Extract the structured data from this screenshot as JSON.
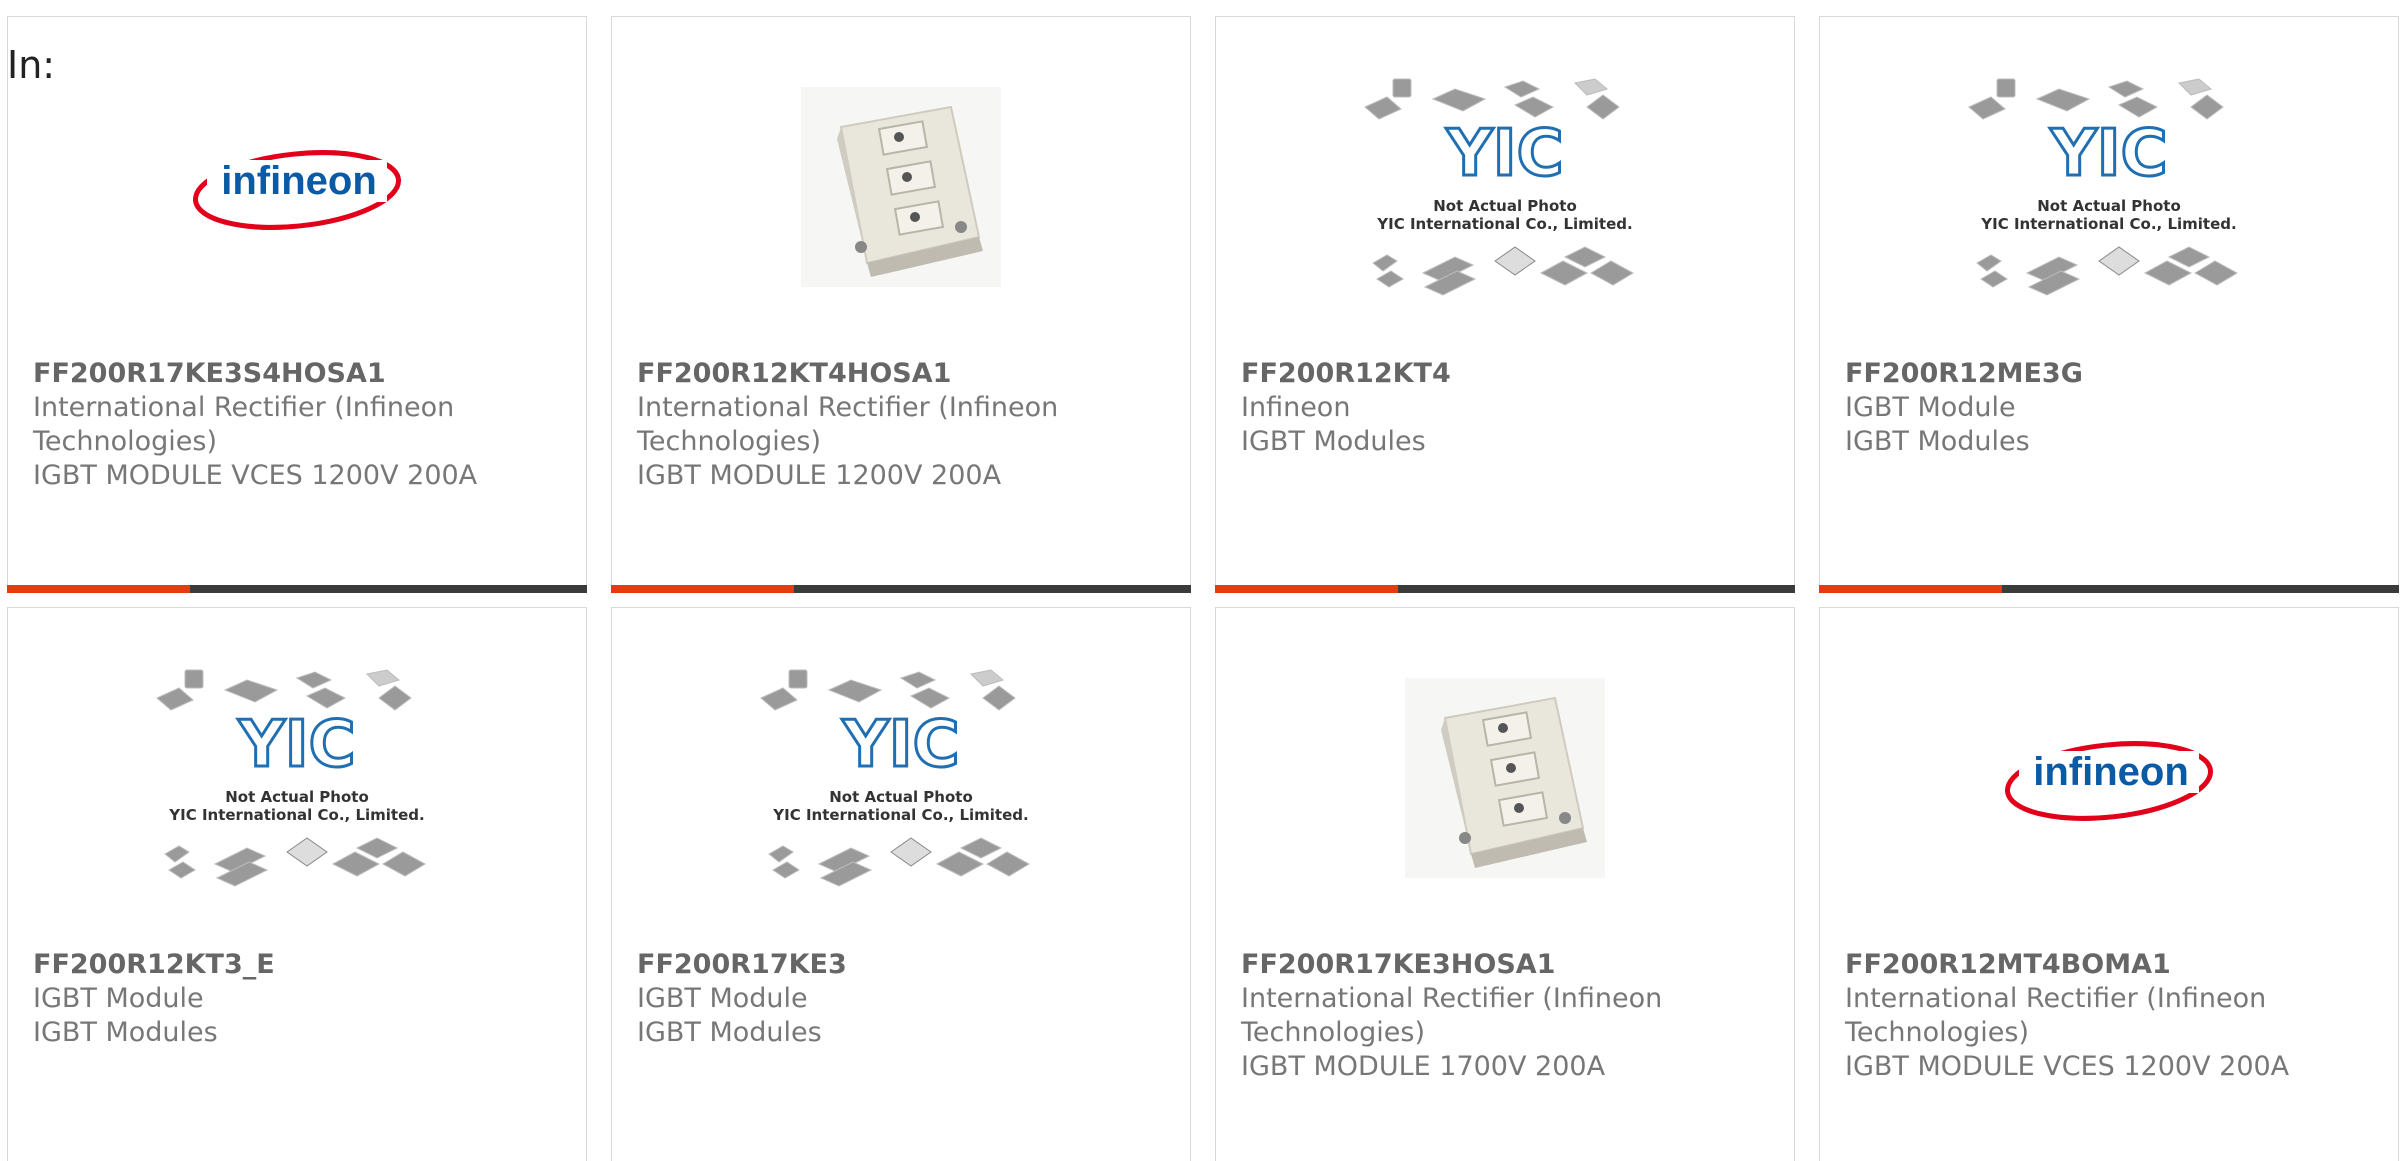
{
  "header": {
    "in_label": "In:"
  },
  "accent_color": "#e63a12",
  "bar_color": "#3b3b3b",
  "products": [
    {
      "part": "FF200R17KE3S4HOSA1",
      "manufacturer": "International Rectifier (Infineon Technologies)",
      "description": "IGBT MODULE VCES 1200V 200A",
      "image": "infineon-logo",
      "logo_text": "infineon"
    },
    {
      "part": "FF200R12KT4HOSA1",
      "manufacturer": "International Rectifier (Infineon Technologies)",
      "description": "IGBT MODULE 1200V 200A",
      "image": "module-photo"
    },
    {
      "part": "FF200R12KT4",
      "manufacturer": "Infineon",
      "description": "IGBT Modules",
      "image": "yic-placeholder",
      "placeholder_line1": "Not Actual Photo",
      "placeholder_line2": "YIC International Co., Limited.",
      "placeholder_logo": "YIC"
    },
    {
      "part": "FF200R12ME3G",
      "manufacturer": "IGBT Module",
      "description": "IGBT Modules",
      "image": "yic-placeholder",
      "placeholder_line1": "Not Actual Photo",
      "placeholder_line2": "YIC International Co., Limited.",
      "placeholder_logo": "YIC"
    },
    {
      "part": "FF200R12KT3_E",
      "manufacturer": "IGBT Module",
      "description": "IGBT Modules",
      "image": "yic-placeholder",
      "placeholder_line1": "Not Actual Photo",
      "placeholder_line2": "YIC International Co., Limited.",
      "placeholder_logo": "YIC"
    },
    {
      "part": "FF200R17KE3",
      "manufacturer": "IGBT Module",
      "description": "IGBT Modules",
      "image": "yic-placeholder",
      "placeholder_line1": "Not Actual Photo",
      "placeholder_line2": "YIC International Co., Limited.",
      "placeholder_logo": "YIC"
    },
    {
      "part": "FF200R17KE3HOSA1",
      "manufacturer": "International Rectifier (Infineon Technologies)",
      "description": "IGBT MODULE 1700V 200A",
      "image": "module-photo"
    },
    {
      "part": "FF200R12MT4BOMA1",
      "manufacturer": "International Rectifier (Infineon Technologies)",
      "description": "IGBT MODULE VCES 1200V 200A",
      "image": "infineon-logo",
      "logo_text": "infineon"
    }
  ]
}
